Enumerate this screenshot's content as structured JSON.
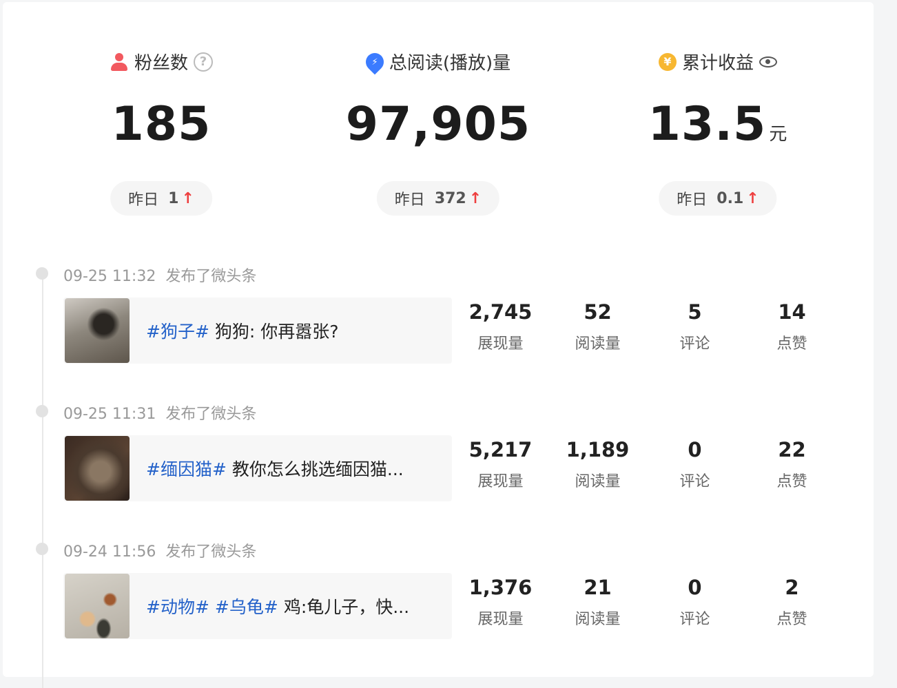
{
  "stats": {
    "fans": {
      "label": "粉丝数",
      "value": "185",
      "yesterday_label": "昨日",
      "yesterday_value": "1"
    },
    "reads": {
      "label": "总阅读(播放)量",
      "value": "97,905",
      "yesterday_label": "昨日",
      "yesterday_value": "372"
    },
    "income": {
      "label": "累计收益",
      "value": "13.5",
      "unit": "元",
      "yesterday_label": "昨日",
      "yesterday_value": "0.1"
    }
  },
  "icons": {
    "up_arrow": "↑",
    "help": "?",
    "coin": "¥",
    "bolt": "⚡"
  },
  "metric_labels": {
    "impressions": "展现量",
    "reads": "阅读量",
    "comments": "评论",
    "likes": "点赞"
  },
  "posts": [
    {
      "time": "09-25 11:32",
      "action": "发布了微头条",
      "tags": [
        "#狗子#"
      ],
      "text": "狗狗: 你再嚣张?",
      "impressions": "2,745",
      "reads": "52",
      "comments": "5",
      "likes": "14"
    },
    {
      "time": "09-25 11:31",
      "action": "发布了微头条",
      "tags": [
        "#缅因猫#"
      ],
      "text": "教你怎么挑选缅因猫...",
      "impressions": "5,217",
      "reads": "1,189",
      "comments": "0",
      "likes": "22"
    },
    {
      "time": "09-24 11:56",
      "action": "发布了微头条",
      "tags": [
        "#动物#",
        "#乌龟#"
      ],
      "text": "鸡:龟儿子，快...",
      "impressions": "1,376",
      "reads": "21",
      "comments": "0",
      "likes": "2"
    }
  ],
  "colors": {
    "tag": "#2361c9",
    "up": "#ee3f3f",
    "fans_icon": "#f2595f",
    "reads_icon": "#3b7bff",
    "coin_icon": "#f7b731"
  }
}
